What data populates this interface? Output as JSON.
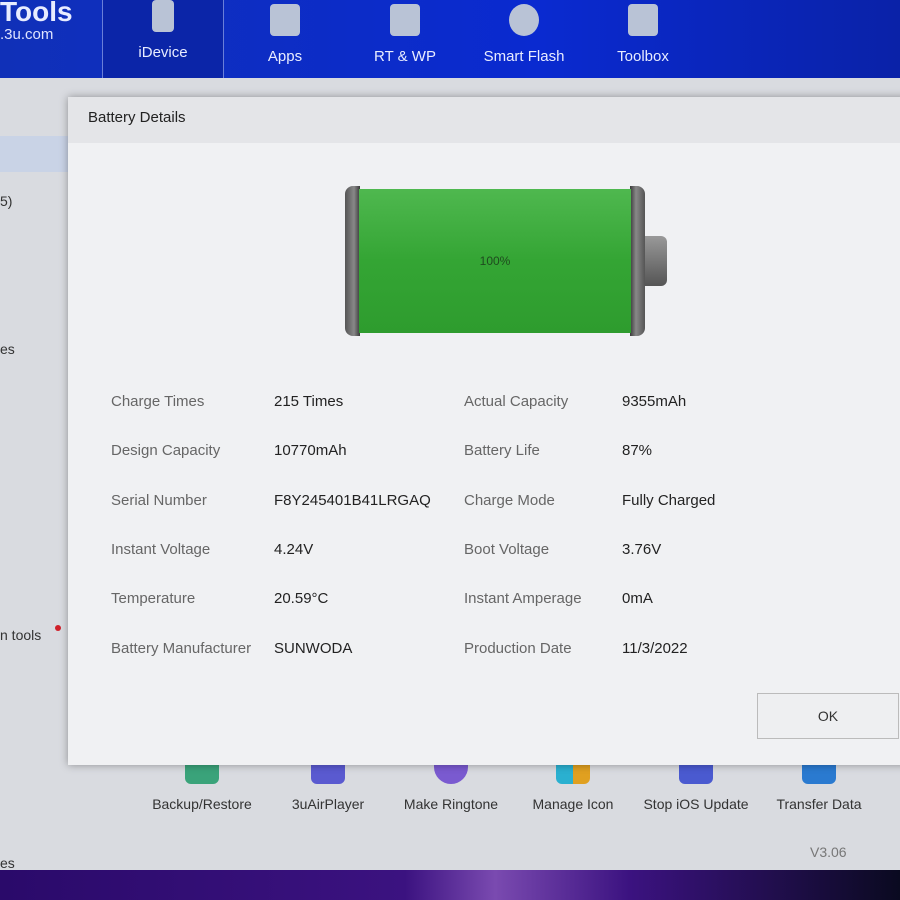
{
  "app": {
    "logo_title": "Tools",
    "logo_sub": ".3u.com"
  },
  "nav": [
    {
      "label": "iDevice",
      "icon": "phone-icon",
      "active": true
    },
    {
      "label": "Apps",
      "icon": "cube-icon"
    },
    {
      "label": "RT & WP",
      "icon": "music-folder-icon"
    },
    {
      "label": "Smart Flash",
      "icon": "shield-refresh-icon"
    },
    {
      "label": "Toolbox",
      "icon": "toolbox-icon"
    }
  ],
  "sidebar": {
    "frag1": "5)",
    "frag2": "es",
    "frag3": "n tools",
    "frag4": "es"
  },
  "dialog": {
    "title": "Battery Details",
    "battery_percent": "100%",
    "battery_level": 100,
    "battery_color": "#3aaa3a",
    "rows": [
      {
        "l1": "Charge Times",
        "v1": "215 Times",
        "l2": "Actual Capacity",
        "v2": "9355mAh"
      },
      {
        "l1": "Design Capacity",
        "v1": "10770mAh",
        "l2": "Battery Life",
        "v2": "87%"
      },
      {
        "l1": "Serial Number",
        "v1": "F8Y245401B41LRGAQ",
        "l2": "Charge Mode",
        "v2": "Fully Charged"
      },
      {
        "l1": "Instant Voltage",
        "v1": "4.24V",
        "l2": "Boot Voltage",
        "v2": "3.76V"
      },
      {
        "l1": "Temperature",
        "v1": "20.59°C",
        "l2": "Instant Amperage",
        "v2": "0mA"
      },
      {
        "l1": "Battery Manufacturer",
        "v1": "SUNWODA",
        "l2": "Production Date",
        "v2": "11/3/2022"
      }
    ],
    "ok_label": "OK"
  },
  "tools": [
    {
      "label": "Backup/Restore",
      "color": "#3aa37a"
    },
    {
      "label": "3uAirPlayer",
      "color": "#5a5ad0"
    },
    {
      "label": "Make Ringtone",
      "color": "#7a5ad0"
    },
    {
      "label": "Manage Icon",
      "color": "#2ab0d0"
    },
    {
      "label": "Stop iOS Update",
      "color": "#4a5ad0"
    },
    {
      "label": "Transfer Data",
      "color": "#2a7ad0"
    }
  ],
  "status": {
    "version": "V3.06"
  }
}
